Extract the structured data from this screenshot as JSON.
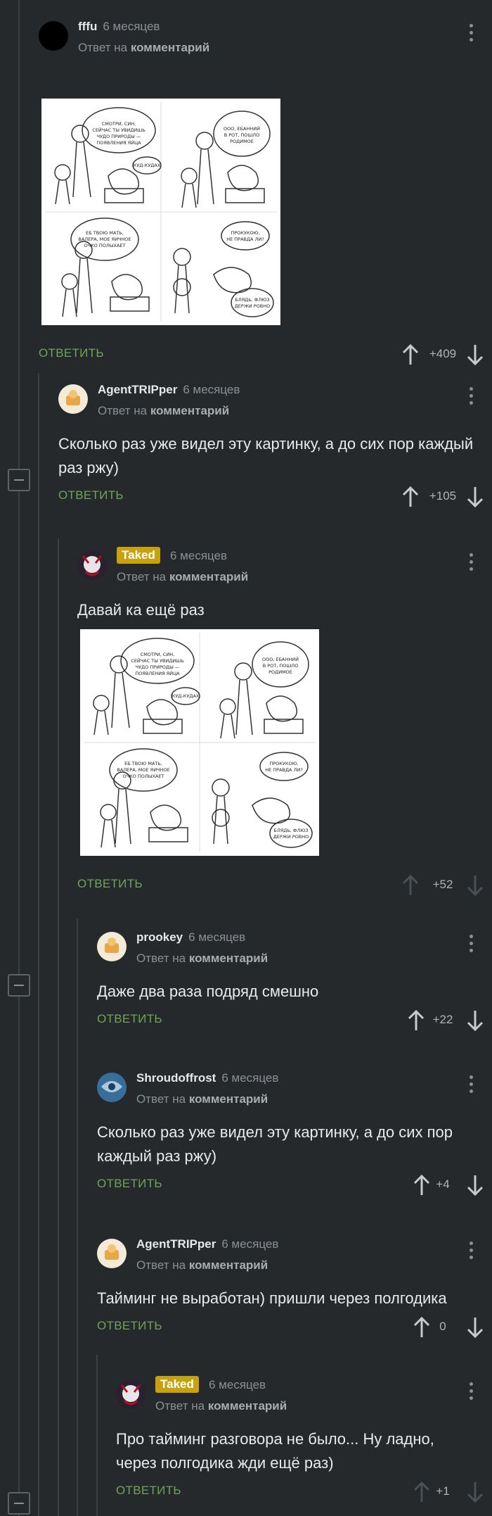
{
  "labels": {
    "reply_to": "Ответ на",
    "comment_word": "комментарий",
    "reply_button": "ОТВЕТИТЬ"
  },
  "comments": [
    {
      "author": "fffu",
      "time": "6 месяцев",
      "score": "+409"
    },
    {
      "author": "AgentTRIPper",
      "time": "6 месяцев",
      "text": "Сколько раз уже видел эту картинку, а до сих пор каждый раз ржу)",
      "score": "+105"
    },
    {
      "author": "Taked",
      "time": "6 месяцев",
      "text": "Давай ка ещё раз",
      "score": "+52"
    },
    {
      "author": "prookey",
      "time": "6 месяцев",
      "text": "Даже два раза подряд смешно",
      "score": "+22"
    },
    {
      "author": "Shroudoffrost",
      "time": "6 месяцев",
      "text": "Сколько раз уже видел эту картинку, а до сих пор каждый раз ржу)",
      "score": "+4"
    },
    {
      "author": "AgentTRIPper",
      "time": "6 месяцев",
      "text": "Тайминг не выработан) пришли через полгодика",
      "score": "0"
    },
    {
      "author": "Taked",
      "time": "6 месяцев",
      "text": "Про тайминг разговора не было... Ну ладно, через полгодика жди ещё раз)",
      "score": "+1"
    }
  ],
  "comic": {
    "panel1_speech": "СМОТРИ, СИН, СЕЙЧАС ТЫ УВИДИШЬ ЧУДО ПРИРОДЫ — ПОЯВЛЕНИЯ ЯЙЦА",
    "panel1_hen": "КУД-КУДАХ",
    "panel2_speech": "ООО, ЕБАННИЙ В РОТ, ПОШЛО РОДИМОЕ",
    "panel3_speech": "ЕБ ТВОЮ МАТЬ, ВАЛЕРА, МОЕ ЯИЧНОЕ ОЧКО ПОЛЫХАЕТ",
    "panel4_speech": "ПРОКУКОЮ, НЕ ПРАВДА ЛИ?",
    "panel4_reply": "БЛЯДЬ, ФЛЮЗ ДЕРЖИ РОВНО"
  },
  "colors": {
    "background": "#25292b",
    "reply_green": "#6fa45a",
    "badge_gold": "#c8a20e",
    "thread_line": "#3c4144"
  }
}
